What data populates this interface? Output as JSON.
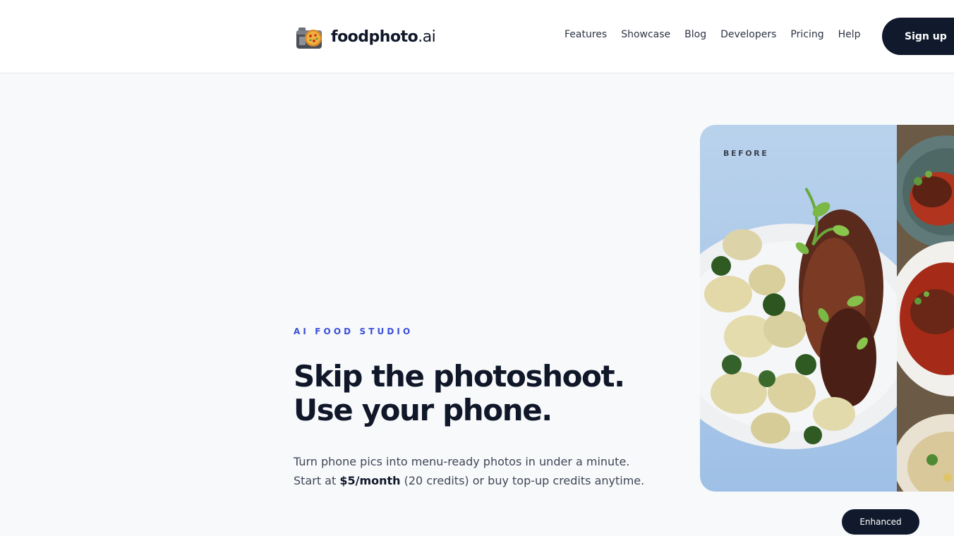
{
  "brand": {
    "name": "foodphoto",
    "tld": ".ai"
  },
  "nav": {
    "items": [
      {
        "label": "Features"
      },
      {
        "label": "Showcase"
      },
      {
        "label": "Blog"
      },
      {
        "label": "Developers"
      },
      {
        "label": "Pricing"
      },
      {
        "label": "Help"
      }
    ],
    "signup_label": "Sign up"
  },
  "hero": {
    "eyebrow": "AI FOOD STUDIO",
    "headline_line1": "Skip the photoshoot.",
    "headline_line2": "Use your phone.",
    "sub_before": "Turn phone pics into menu-ready photos in under a minute. Start at ",
    "sub_bold": "$5/month",
    "sub_after": " (20 credits) or buy top-up credits anytime."
  },
  "showcase": {
    "before_label": "BEFORE",
    "enhanced_label": "Enhanced"
  },
  "colors": {
    "accent": "#3b4fd8",
    "dark": "#111a2c",
    "background": "#f8f9fb"
  },
  "icons": {
    "logo": "camera-pizza-icon"
  }
}
